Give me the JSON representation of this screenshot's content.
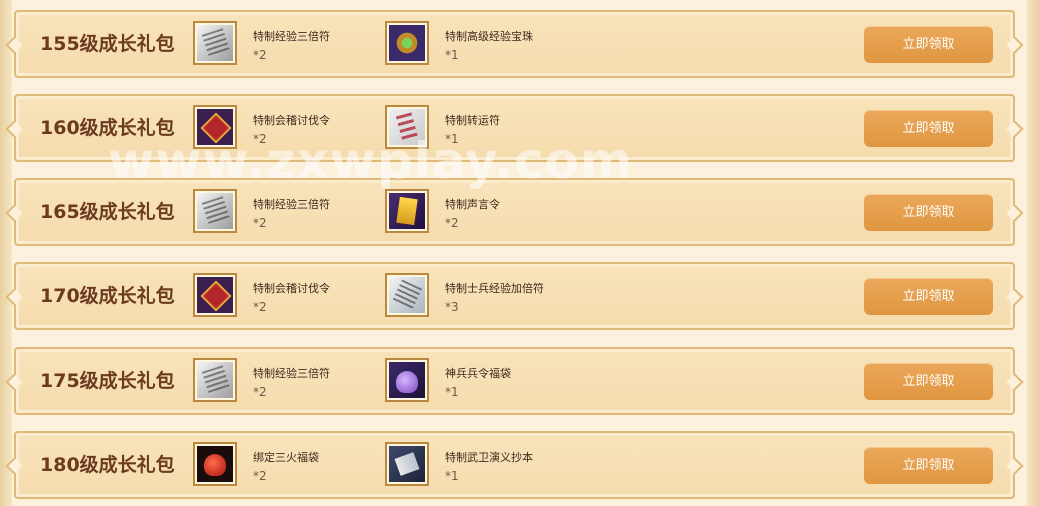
{
  "watermark": "www.zxwplay.com",
  "packs": [
    {
      "title": "155级成长礼包",
      "button": "立即领取",
      "items": [
        {
          "name": "特制经验三倍符",
          "qty": "*2",
          "icon": "exp-talisman-icon"
        },
        {
          "name": "特制高级经验宝珠",
          "qty": "*1",
          "icon": "exp-orb-icon"
        }
      ]
    },
    {
      "title": "160级成长礼包",
      "button": "立即领取",
      "items": [
        {
          "name": "特制会稽讨伐令",
          "qty": "*2",
          "icon": "crusade-token-icon"
        },
        {
          "name": "特制转运符",
          "qty": "*1",
          "icon": "luck-talisman-icon"
        }
      ]
    },
    {
      "title": "165级成长礼包",
      "button": "立即领取",
      "items": [
        {
          "name": "特制经验三倍符",
          "qty": "*2",
          "icon": "exp-talisman-icon"
        },
        {
          "name": "特制声言令",
          "qty": "*2",
          "icon": "decree-scroll-icon"
        }
      ]
    },
    {
      "title": "170级成长礼包",
      "button": "立即领取",
      "items": [
        {
          "name": "特制会稽讨伐令",
          "qty": "*2",
          "icon": "crusade-token-icon"
        },
        {
          "name": "特制士兵经验加倍符",
          "qty": "*3",
          "icon": "soldier-exp-talisman-icon"
        }
      ]
    },
    {
      "title": "175级成长礼包",
      "button": "立即领取",
      "items": [
        {
          "name": "特制经验三倍符",
          "qty": "*2",
          "icon": "exp-talisman-icon"
        },
        {
          "name": "神兵兵令福袋",
          "qty": "*1",
          "icon": "purple-lucky-bag-icon"
        }
      ]
    },
    {
      "title": "180级成长礼包",
      "button": "立即领取",
      "items": [
        {
          "name": "绑定三火福袋",
          "qty": "*2",
          "icon": "red-lucky-bag-icon"
        },
        {
          "name": "特制武卫演义抄本",
          "qty": "*1",
          "icon": "manuscript-book-icon"
        }
      ]
    }
  ]
}
